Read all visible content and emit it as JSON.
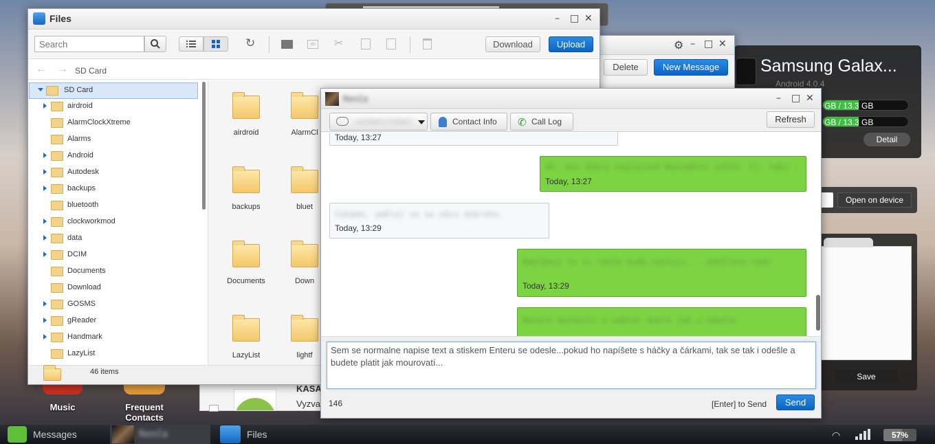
{
  "files": {
    "title": "Files",
    "search_placeholder": "Search",
    "download_label": "Download",
    "upload_label": "Upload",
    "path": "SD Card",
    "tree_root": "SD Card",
    "tree": [
      "airdroid",
      "AlarmClockXtreme",
      "Alarms",
      "Android",
      "Autodesk",
      "backups",
      "bluetooth",
      "clockworkmod",
      "data",
      "DCIM",
      "Documents",
      "Download",
      "GOSMS",
      "gReader",
      "Handmark",
      "LazyList"
    ],
    "grid": [
      "airdroid",
      "AlarmCl",
      "backups",
      "bluet",
      "Documents",
      "Down",
      "LazyList",
      "lightf"
    ],
    "status": "46 items"
  },
  "messages_win": {
    "delete_label": "Delete",
    "new_message_label": "New Message"
  },
  "device": {
    "name": "Samsung Galax...",
    "os": "Android 4.0.4",
    "storage1": "GB / 13.3 GB",
    "storage2": "GB / 13.3 GB",
    "detail_label": "Detail",
    "open_on_device_label": "Open on device",
    "save_label": "Save"
  },
  "chat": {
    "contact_name": "Renča",
    "phone": "+420601739847",
    "tab_contact_info": "Contact Info",
    "tab_call_log": "Call Log",
    "refresh_label": "Refresh",
    "messages": [
      {
        "dir": "in",
        "time": "Today, 13:27"
      },
      {
        "dir": "out",
        "text": "Ok, moc dobrý neplacené Maximální ještě, tj, taky :-P",
        "time": "Today, 13:27"
      },
      {
        "dir": "in",
        "text": "Čekáme, udělej se se něco dobrého.",
        "time": "Today, 13:29"
      },
      {
        "dir": "out",
        "text": "Naplánuj to si takže bude nestojí... odešlete tady",
        "time": "Today, 13:29"
      },
      {
        "dir": "out",
        "text": "Nenech možnosti a udělat dobre jak u odešle",
        "time": ""
      }
    ],
    "compose_text": "Sem se normalne napise text a stiskem Enteru se odesle...pokud ho napíšete s háčky a čárkami, tak se tak i odešle a budete platit jak mourovatí...",
    "char_count": "146",
    "enter_hint": "[Enter] to Send",
    "send_label": "Send"
  },
  "desktop": {
    "music_label": "Music",
    "frequent_contacts_label": "Frequent Contacts",
    "kasa_label": "KASA",
    "vyzva_label": "Vyzva"
  },
  "taskbar": {
    "messages_label": "Messages",
    "contact_label": "Renča",
    "files_label": "Files",
    "battery": "57%"
  }
}
